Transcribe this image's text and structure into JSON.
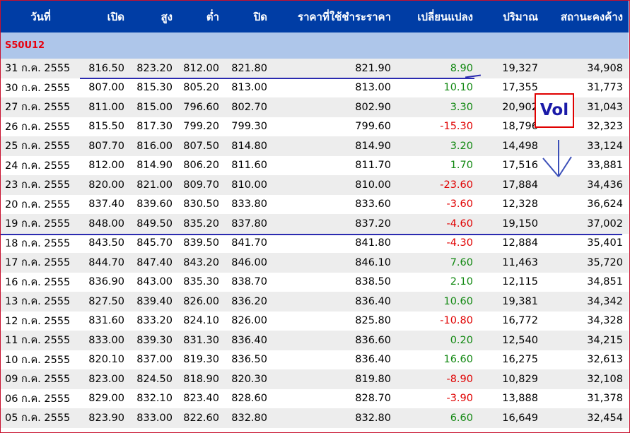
{
  "columns": [
    "วันที่",
    "เปิด",
    "สูง",
    "ต่ำ",
    "ปิด",
    "ราคาที่ใช้ชำระราคา",
    "เปลี่ยนแปลง",
    "ปริมาณ",
    "สถานะคงค้าง"
  ],
  "series_name": "S50U12",
  "annotation": "Vol",
  "colors": {
    "header_bg": "#003da5",
    "series_bg": "#aec6ea",
    "up": "#118811",
    "down": "#e00000",
    "marker_line": "#2b2bb0"
  },
  "icons": {
    "annotation_arrow": "down-arrow-icon"
  },
  "rows": [
    {
      "date": "31 ก.ค. 2555",
      "open": "816.50",
      "high": "823.20",
      "low": "812.00",
      "close": "821.80",
      "settle": "821.90",
      "change": "8.90",
      "dir": "up",
      "volume": "19,327",
      "oi": "34,908"
    },
    {
      "date": "30 ก.ค. 2555",
      "open": "807.00",
      "high": "815.30",
      "low": "805.20",
      "close": "813.00",
      "settle": "813.00",
      "change": "10.10",
      "dir": "up",
      "volume": "17,355",
      "oi": "31,773"
    },
    {
      "date": "27 ก.ค. 2555",
      "open": "811.00",
      "high": "815.00",
      "low": "796.60",
      "close": "802.70",
      "settle": "802.90",
      "change": "3.30",
      "dir": "up",
      "volume": "20,902",
      "oi": "31,043"
    },
    {
      "date": "26 ก.ค. 2555",
      "open": "815.50",
      "high": "817.30",
      "low": "799.20",
      "close": "799.30",
      "settle": "799.60",
      "change": "-15.30",
      "dir": "down",
      "volume": "18,796",
      "oi": "32,323"
    },
    {
      "date": "25 ก.ค. 2555",
      "open": "807.70",
      "high": "816.00",
      "low": "807.50",
      "close": "814.80",
      "settle": "814.90",
      "change": "3.20",
      "dir": "up",
      "volume": "14,498",
      "oi": "33,124"
    },
    {
      "date": "24 ก.ค. 2555",
      "open": "812.00",
      "high": "814.90",
      "low": "806.20",
      "close": "811.60",
      "settle": "811.70",
      "change": "1.70",
      "dir": "up",
      "volume": "17,516",
      "oi": "33,881"
    },
    {
      "date": "23 ก.ค. 2555",
      "open": "820.00",
      "high": "821.00",
      "low": "809.70",
      "close": "810.00",
      "settle": "810.00",
      "change": "-23.60",
      "dir": "down",
      "volume": "17,884",
      "oi": "34,436"
    },
    {
      "date": "20 ก.ค. 2555",
      "open": "837.40",
      "high": "839.60",
      "low": "830.50",
      "close": "833.80",
      "settle": "833.60",
      "change": "-3.60",
      "dir": "down",
      "volume": "12,328",
      "oi": "36,624"
    },
    {
      "date": "19 ก.ค. 2555",
      "open": "848.00",
      "high": "849.50",
      "low": "835.20",
      "close": "837.80",
      "settle": "837.20",
      "change": "-4.60",
      "dir": "down",
      "volume": "19,150",
      "oi": "37,002"
    },
    {
      "date": "18 ก.ค. 2555",
      "open": "843.50",
      "high": "845.70",
      "low": "839.50",
      "close": "841.70",
      "settle": "841.80",
      "change": "-4.30",
      "dir": "down",
      "volume": "12,884",
      "oi": "35,401"
    },
    {
      "date": "17 ก.ค. 2555",
      "open": "844.70",
      "high": "847.40",
      "low": "843.20",
      "close": "846.00",
      "settle": "846.10",
      "change": "7.60",
      "dir": "up",
      "volume": "11,463",
      "oi": "35,720"
    },
    {
      "date": "16 ก.ค. 2555",
      "open": "836.90",
      "high": "843.00",
      "low": "835.30",
      "close": "838.70",
      "settle": "838.50",
      "change": "2.10",
      "dir": "up",
      "volume": "12,115",
      "oi": "34,851"
    },
    {
      "date": "13 ก.ค. 2555",
      "open": "827.50",
      "high": "839.40",
      "low": "826.00",
      "close": "836.20",
      "settle": "836.40",
      "change": "10.60",
      "dir": "up",
      "volume": "19,381",
      "oi": "34,342"
    },
    {
      "date": "12 ก.ค. 2555",
      "open": "831.60",
      "high": "833.20",
      "low": "824.10",
      "close": "826.00",
      "settle": "825.80",
      "change": "-10.80",
      "dir": "down",
      "volume": "16,772",
      "oi": "34,328"
    },
    {
      "date": "11 ก.ค. 2555",
      "open": "833.00",
      "high": "839.30",
      "low": "831.30",
      "close": "836.40",
      "settle": "836.60",
      "change": "0.20",
      "dir": "up",
      "volume": "12,540",
      "oi": "34,215"
    },
    {
      "date": "10 ก.ค. 2555",
      "open": "820.10",
      "high": "837.00",
      "low": "819.30",
      "close": "836.50",
      "settle": "836.40",
      "change": "16.60",
      "dir": "up",
      "volume": "16,275",
      "oi": "32,613"
    },
    {
      "date": "09 ก.ค. 2555",
      "open": "823.00",
      "high": "824.50",
      "low": "818.90",
      "close": "820.30",
      "settle": "819.80",
      "change": "-8.90",
      "dir": "down",
      "volume": "10,829",
      "oi": "32,108"
    },
    {
      "date": "06 ก.ค. 2555",
      "open": "829.00",
      "high": "832.10",
      "low": "823.40",
      "close": "828.60",
      "settle": "828.70",
      "change": "-3.90",
      "dir": "down",
      "volume": "13,888",
      "oi": "31,378"
    },
    {
      "date": "05 ก.ค. 2555",
      "open": "823.90",
      "high": "833.00",
      "low": "822.60",
      "close": "832.80",
      "settle": "832.80",
      "change": "6.60",
      "dir": "up",
      "volume": "16,649",
      "oi": "32,454"
    }
  ]
}
